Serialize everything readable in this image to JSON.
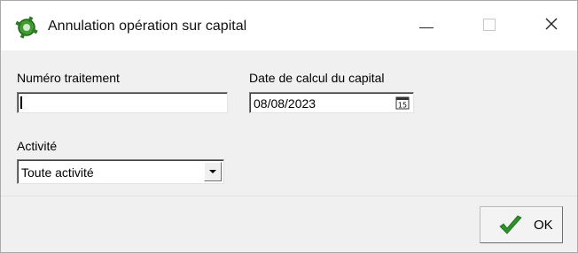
{
  "window": {
    "title": "Annulation opération sur capital",
    "icons": {
      "app": "settings-gear-icon",
      "minimize": "minimize-icon",
      "maximize": "maximize-icon",
      "close": "close-icon"
    },
    "accent_color": "#2e8b22"
  },
  "form": {
    "numero_traitement": {
      "label": "Numéro traitement",
      "value": ""
    },
    "date_calcul": {
      "label": "Date de calcul du capital",
      "value": "08/08/2023",
      "icon": "calendar-icon"
    },
    "activite": {
      "label": "Activité",
      "selected": "Toute activité",
      "icon": "chevron-down-icon"
    }
  },
  "footer": {
    "ok_label": "OK",
    "ok_icon": "checkmark-icon",
    "ok_icon_color": "#2f8f2a"
  }
}
